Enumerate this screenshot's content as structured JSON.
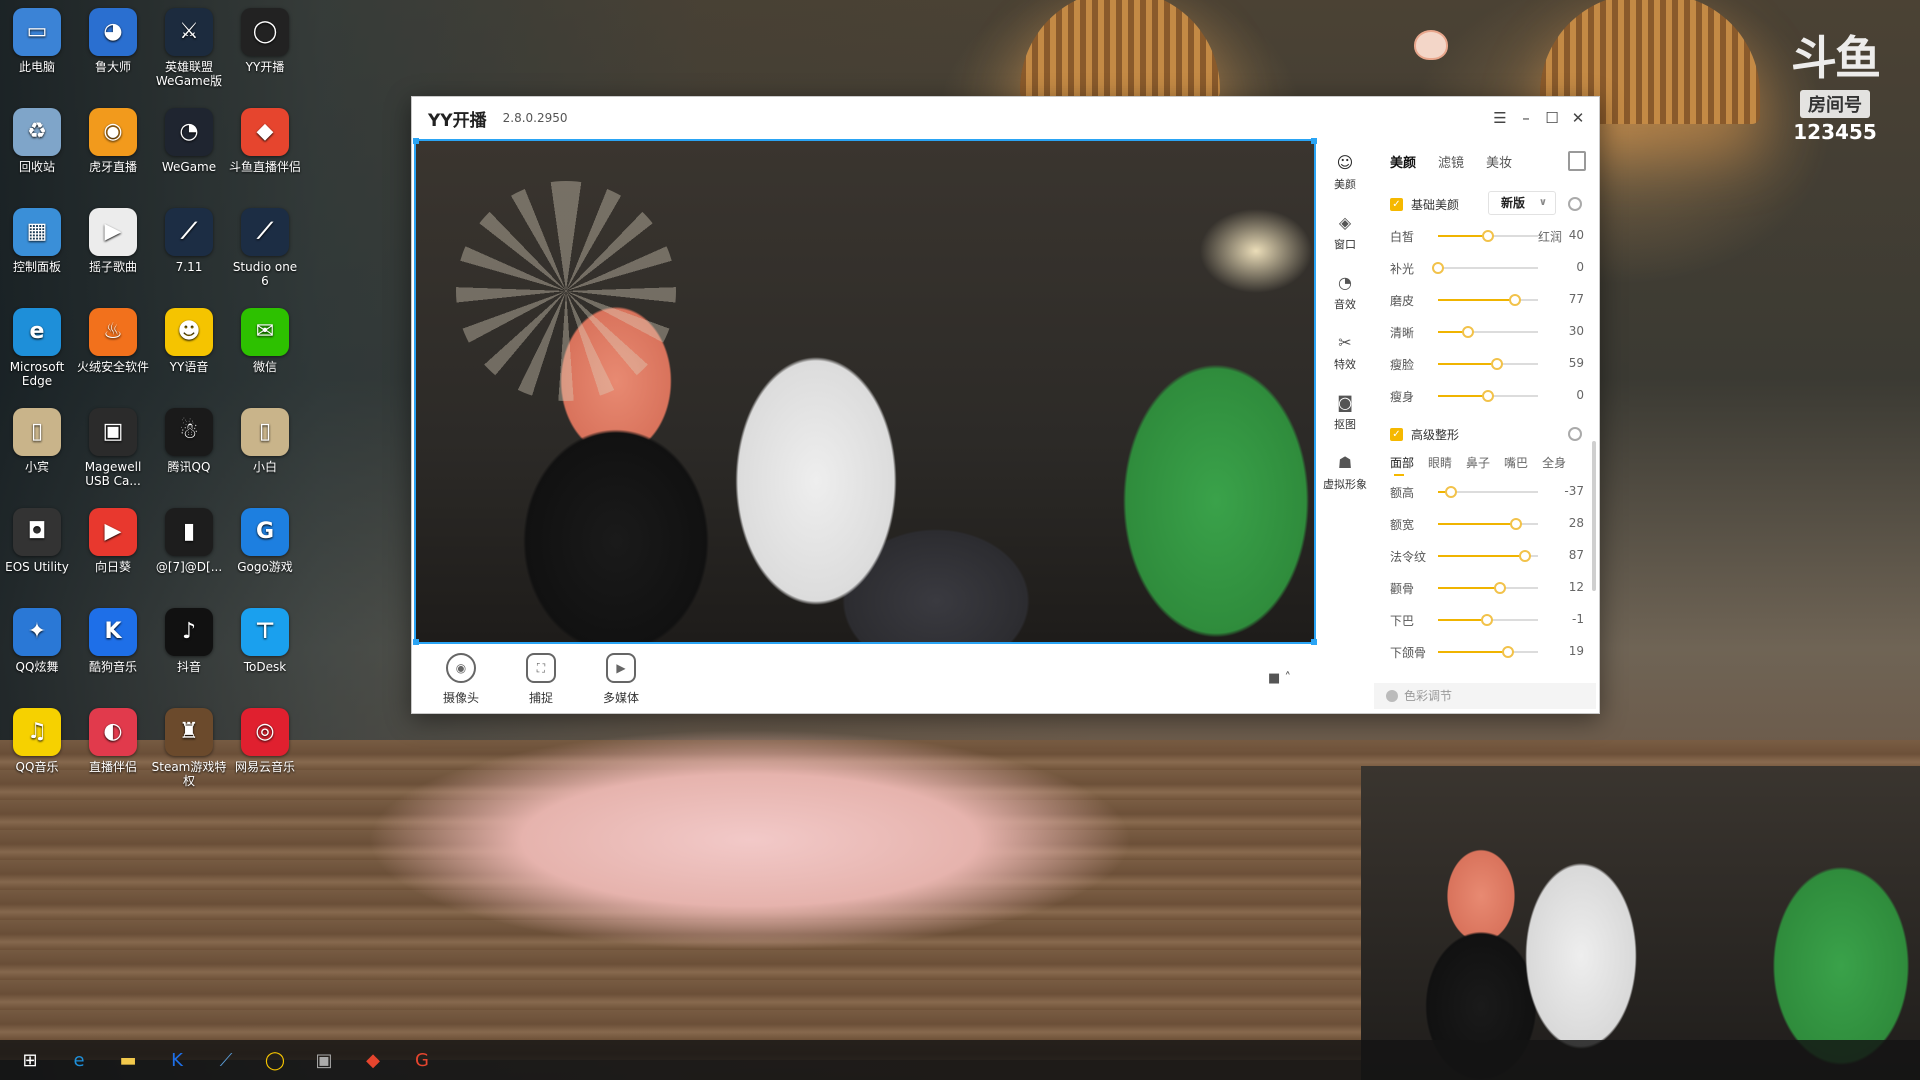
{
  "brand": {
    "logo": "斗鱼",
    "room_label": "房间号",
    "room_number": "123455"
  },
  "desktop_icons": [
    {
      "label": "此电脑",
      "color": "#3b83d6",
      "glyph": "▭"
    },
    {
      "label": "鲁大师",
      "color": "#2a6fd0",
      "glyph": "◕"
    },
    {
      "label": "英雄联盟\nWeGame版",
      "color": "#1c2b3e",
      "glyph": "⚔"
    },
    {
      "label": "YY开播",
      "color": "#222222",
      "glyph": "◯"
    },
    {
      "label": "回收站",
      "color": "#7fa5c9",
      "glyph": "♻"
    },
    {
      "label": "虎牙直播",
      "color": "#f29a1c",
      "glyph": "◉"
    },
    {
      "label": "WeGame",
      "color": "#1f2530",
      "glyph": "◔"
    },
    {
      "label": "斗鱼直播伴侣",
      "color": "#e6452e",
      "glyph": "◆"
    },
    {
      "label": "控制面板",
      "color": "#3a8fd8",
      "glyph": "▦"
    },
    {
      "label": "摇子歌曲",
      "color": "#ececec",
      "glyph": "▶"
    },
    {
      "label": "7.11",
      "color": "#1c2d44",
      "glyph": "⟋"
    },
    {
      "label": "Studio one\n6",
      "color": "#1c2d44",
      "glyph": "⟋"
    },
    {
      "label": "Microsoft\nEdge",
      "color": "#1e8fd9",
      "glyph": "e"
    },
    {
      "label": "火绒安全软件",
      "color": "#f2711c",
      "glyph": "♨"
    },
    {
      "label": "YY语音",
      "color": "#f5c400",
      "glyph": "☻"
    },
    {
      "label": "微信",
      "color": "#2dc100",
      "glyph": "✉"
    },
    {
      "label": "小宾",
      "color": "#c9b48a",
      "glyph": "▯"
    },
    {
      "label": "Magewell\nUSB Ca...",
      "color": "#2b2b2b",
      "glyph": "▣"
    },
    {
      "label": "腾讯QQ",
      "color": "#1a1a1a",
      "glyph": "☃"
    },
    {
      "label": "小白",
      "color": "#c9b48a",
      "glyph": "▯"
    },
    {
      "label": "EOS Utility",
      "color": "#333333",
      "glyph": "◘"
    },
    {
      "label": "向日葵",
      "color": "#e8382e",
      "glyph": "▶"
    },
    {
      "label": "@[7]@D[...",
      "color": "#1d1d1d",
      "glyph": "▮"
    },
    {
      "label": "Gogo游戏",
      "color": "#1d7fe0",
      "glyph": "G"
    },
    {
      "label": "QQ炫舞",
      "color": "#2a78d6",
      "glyph": "✦"
    },
    {
      "label": "酷狗音乐",
      "color": "#1e6fe8",
      "glyph": "K"
    },
    {
      "label": "抖音",
      "color": "#111111",
      "glyph": "♪"
    },
    {
      "label": "ToDesk",
      "color": "#1aa0ee",
      "glyph": "⊤"
    },
    {
      "label": "QQ音乐",
      "color": "#f6d100",
      "glyph": "♫"
    },
    {
      "label": "直播伴侣",
      "color": "#e13a4c",
      "glyph": "◐"
    },
    {
      "label": "Steam游戏特\n权",
      "color": "#6b4a2c",
      "glyph": "♜"
    },
    {
      "label": "网易云音乐",
      "color": "#e0202f",
      "glyph": "◎"
    }
  ],
  "yy": {
    "app_title": "YY开播",
    "version": "2.8.0.2950",
    "bottom_tools": [
      {
        "label": "摄像头",
        "glyph": "◉"
      },
      {
        "label": "捕捉",
        "glyph": "⛶"
      },
      {
        "label": "多媒体",
        "glyph": "▶"
      }
    ],
    "side_tabs": [
      {
        "label": "美颜",
        "glyph": "☺"
      },
      {
        "label": "窗口",
        "glyph": "◈"
      },
      {
        "label": "音效",
        "glyph": "◔"
      },
      {
        "label": "特效",
        "glyph": "✂"
      },
      {
        "label": "抠图",
        "glyph": "◙"
      },
      {
        "label": "虚拟形象",
        "glyph": "☗"
      }
    ],
    "beauty": {
      "tabs": [
        "美颜",
        "滤镜",
        "美妆"
      ],
      "basic_label": "基础美颜",
      "version_select": "新版",
      "basic_sliders": [
        {
          "label": "白皙",
          "value": "40",
          "pos": 0.5,
          "extra": "红润"
        },
        {
          "label": "补光",
          "value": "0",
          "pos": 0.0
        },
        {
          "label": "磨皮",
          "value": "77",
          "pos": 0.77
        },
        {
          "label": "清晰",
          "value": "30",
          "pos": 0.3
        },
        {
          "label": "瘦脸",
          "value": "59",
          "pos": 0.59
        },
        {
          "label": "瘦身",
          "value": "0",
          "pos": 0.5
        }
      ],
      "advanced_label": "高级整形",
      "sub_tabs": [
        "面部",
        "眼睛",
        "鼻子",
        "嘴巴",
        "全身"
      ],
      "advanced_sliders": [
        {
          "label": "额高",
          "value": "-37",
          "pos": 0.13
        },
        {
          "label": "额宽",
          "value": "28",
          "pos": 0.78
        },
        {
          "label": "法令纹",
          "value": "87",
          "pos": 0.87
        },
        {
          "label": "颧骨",
          "value": "12",
          "pos": 0.62
        },
        {
          "label": "下巴",
          "value": "-1",
          "pos": 0.49
        },
        {
          "label": "下颌骨",
          "value": "19",
          "pos": 0.7
        }
      ],
      "color_adjust": "色彩调节"
    }
  },
  "taskbar": [
    {
      "name": "start-icon",
      "glyph": "⊞",
      "color": "#ffffff"
    },
    {
      "name": "edge-icon",
      "glyph": "e",
      "color": "#1e8fd9"
    },
    {
      "name": "explorer-icon",
      "glyph": "▬",
      "color": "#f2c94c"
    },
    {
      "name": "kugou-icon",
      "glyph": "K",
      "color": "#1e6fe8"
    },
    {
      "name": "studio-one-icon",
      "glyph": "⟋",
      "color": "#5a9bd5"
    },
    {
      "name": "yy-icon",
      "glyph": "◯",
      "color": "#f5c400"
    },
    {
      "name": "app-icon",
      "glyph": "▣",
      "color": "#aaaaaa"
    },
    {
      "name": "douyu-icon",
      "glyph": "◆",
      "color": "#e6452e"
    },
    {
      "name": "gogo-icon",
      "glyph": "G",
      "color": "#e6452e"
    }
  ]
}
